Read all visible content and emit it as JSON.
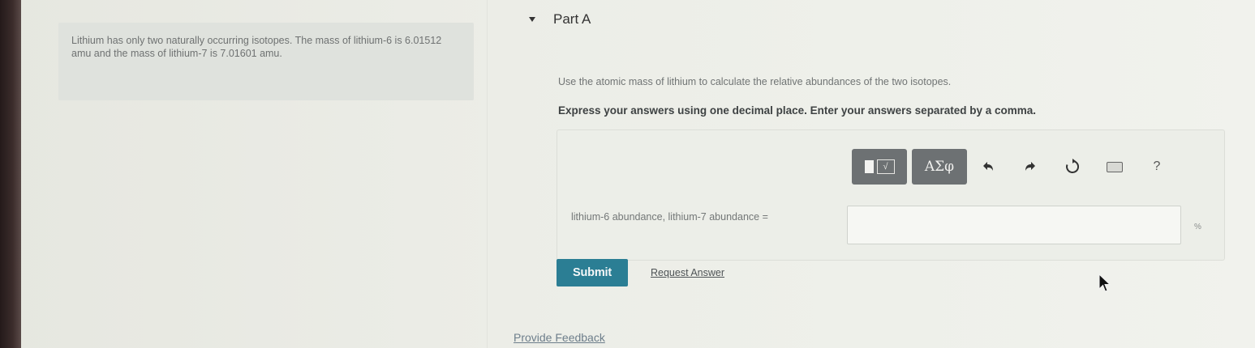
{
  "problem": {
    "text": "Lithium has only two naturally occurring isotopes. The mass of lithium-6 is 6.01512 amu and the mass of lithium-7 is 7.01601 amu."
  },
  "part": {
    "title": "Part A",
    "question": "Use the atomic mass of lithium to calculate the relative abundances of the two isotopes.",
    "instruction": "Express your answers using one decimal place. Enter your answers separated by a comma."
  },
  "toolbar": {
    "templates_icon": "templates-icon",
    "greek_label": "ΑΣφ",
    "undo_icon": "undo-icon",
    "redo_icon": "redo-icon",
    "reset_icon": "reset-icon",
    "keyboard_icon": "keyboard-icon",
    "help_label": "?"
  },
  "answer": {
    "label": "lithium-6 abundance, lithium-7 abundance =",
    "value": "",
    "unit": "%"
  },
  "actions": {
    "submit_label": "Submit",
    "request_answer_label": "Request Answer",
    "feedback_label": "Provide Feedback"
  },
  "colors": {
    "submit_bg": "#2b7e94",
    "toolbar_button_bg": "#6d7173",
    "page_bg": "#eceee8"
  }
}
